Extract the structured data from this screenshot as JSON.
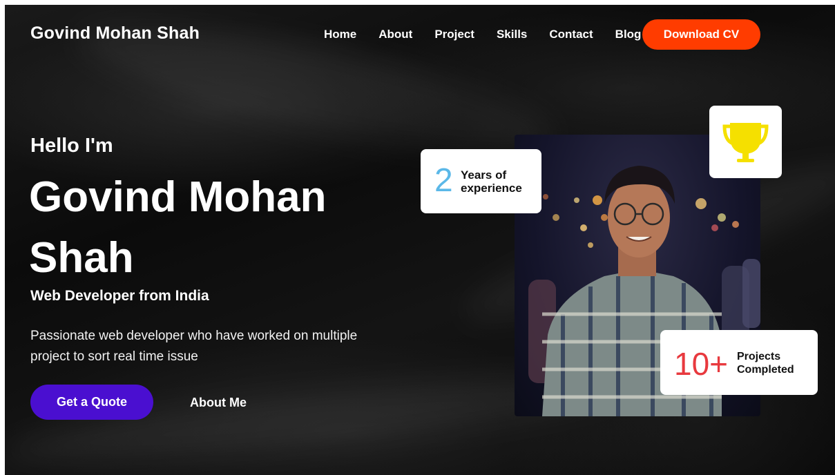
{
  "header": {
    "brand": "Govind Mohan Shah",
    "nav": [
      "Home",
      "About",
      "Project",
      "Skills",
      "Contact",
      "Blog"
    ],
    "cta_label": "Download CV"
  },
  "hero": {
    "greeting": "Hello I'm",
    "name": "Govind Mohan Shah",
    "role": "Web Developer from India",
    "description": "Passionate web developer who have worked on multiple project to sort real time issue",
    "primary_button": "Get a Quote",
    "secondary_link": "About Me"
  },
  "stats": {
    "experience": {
      "value": "2",
      "label": "Years of experience"
    },
    "projects": {
      "value": "10+",
      "label": "Projects Completed"
    },
    "trophy_icon": "trophy-icon"
  },
  "colors": {
    "cta": "#ff3c00",
    "primary": "#4a0fd0",
    "experience": "#5bb8e8",
    "projects": "#e8393e",
    "trophy": "#f5e000"
  }
}
